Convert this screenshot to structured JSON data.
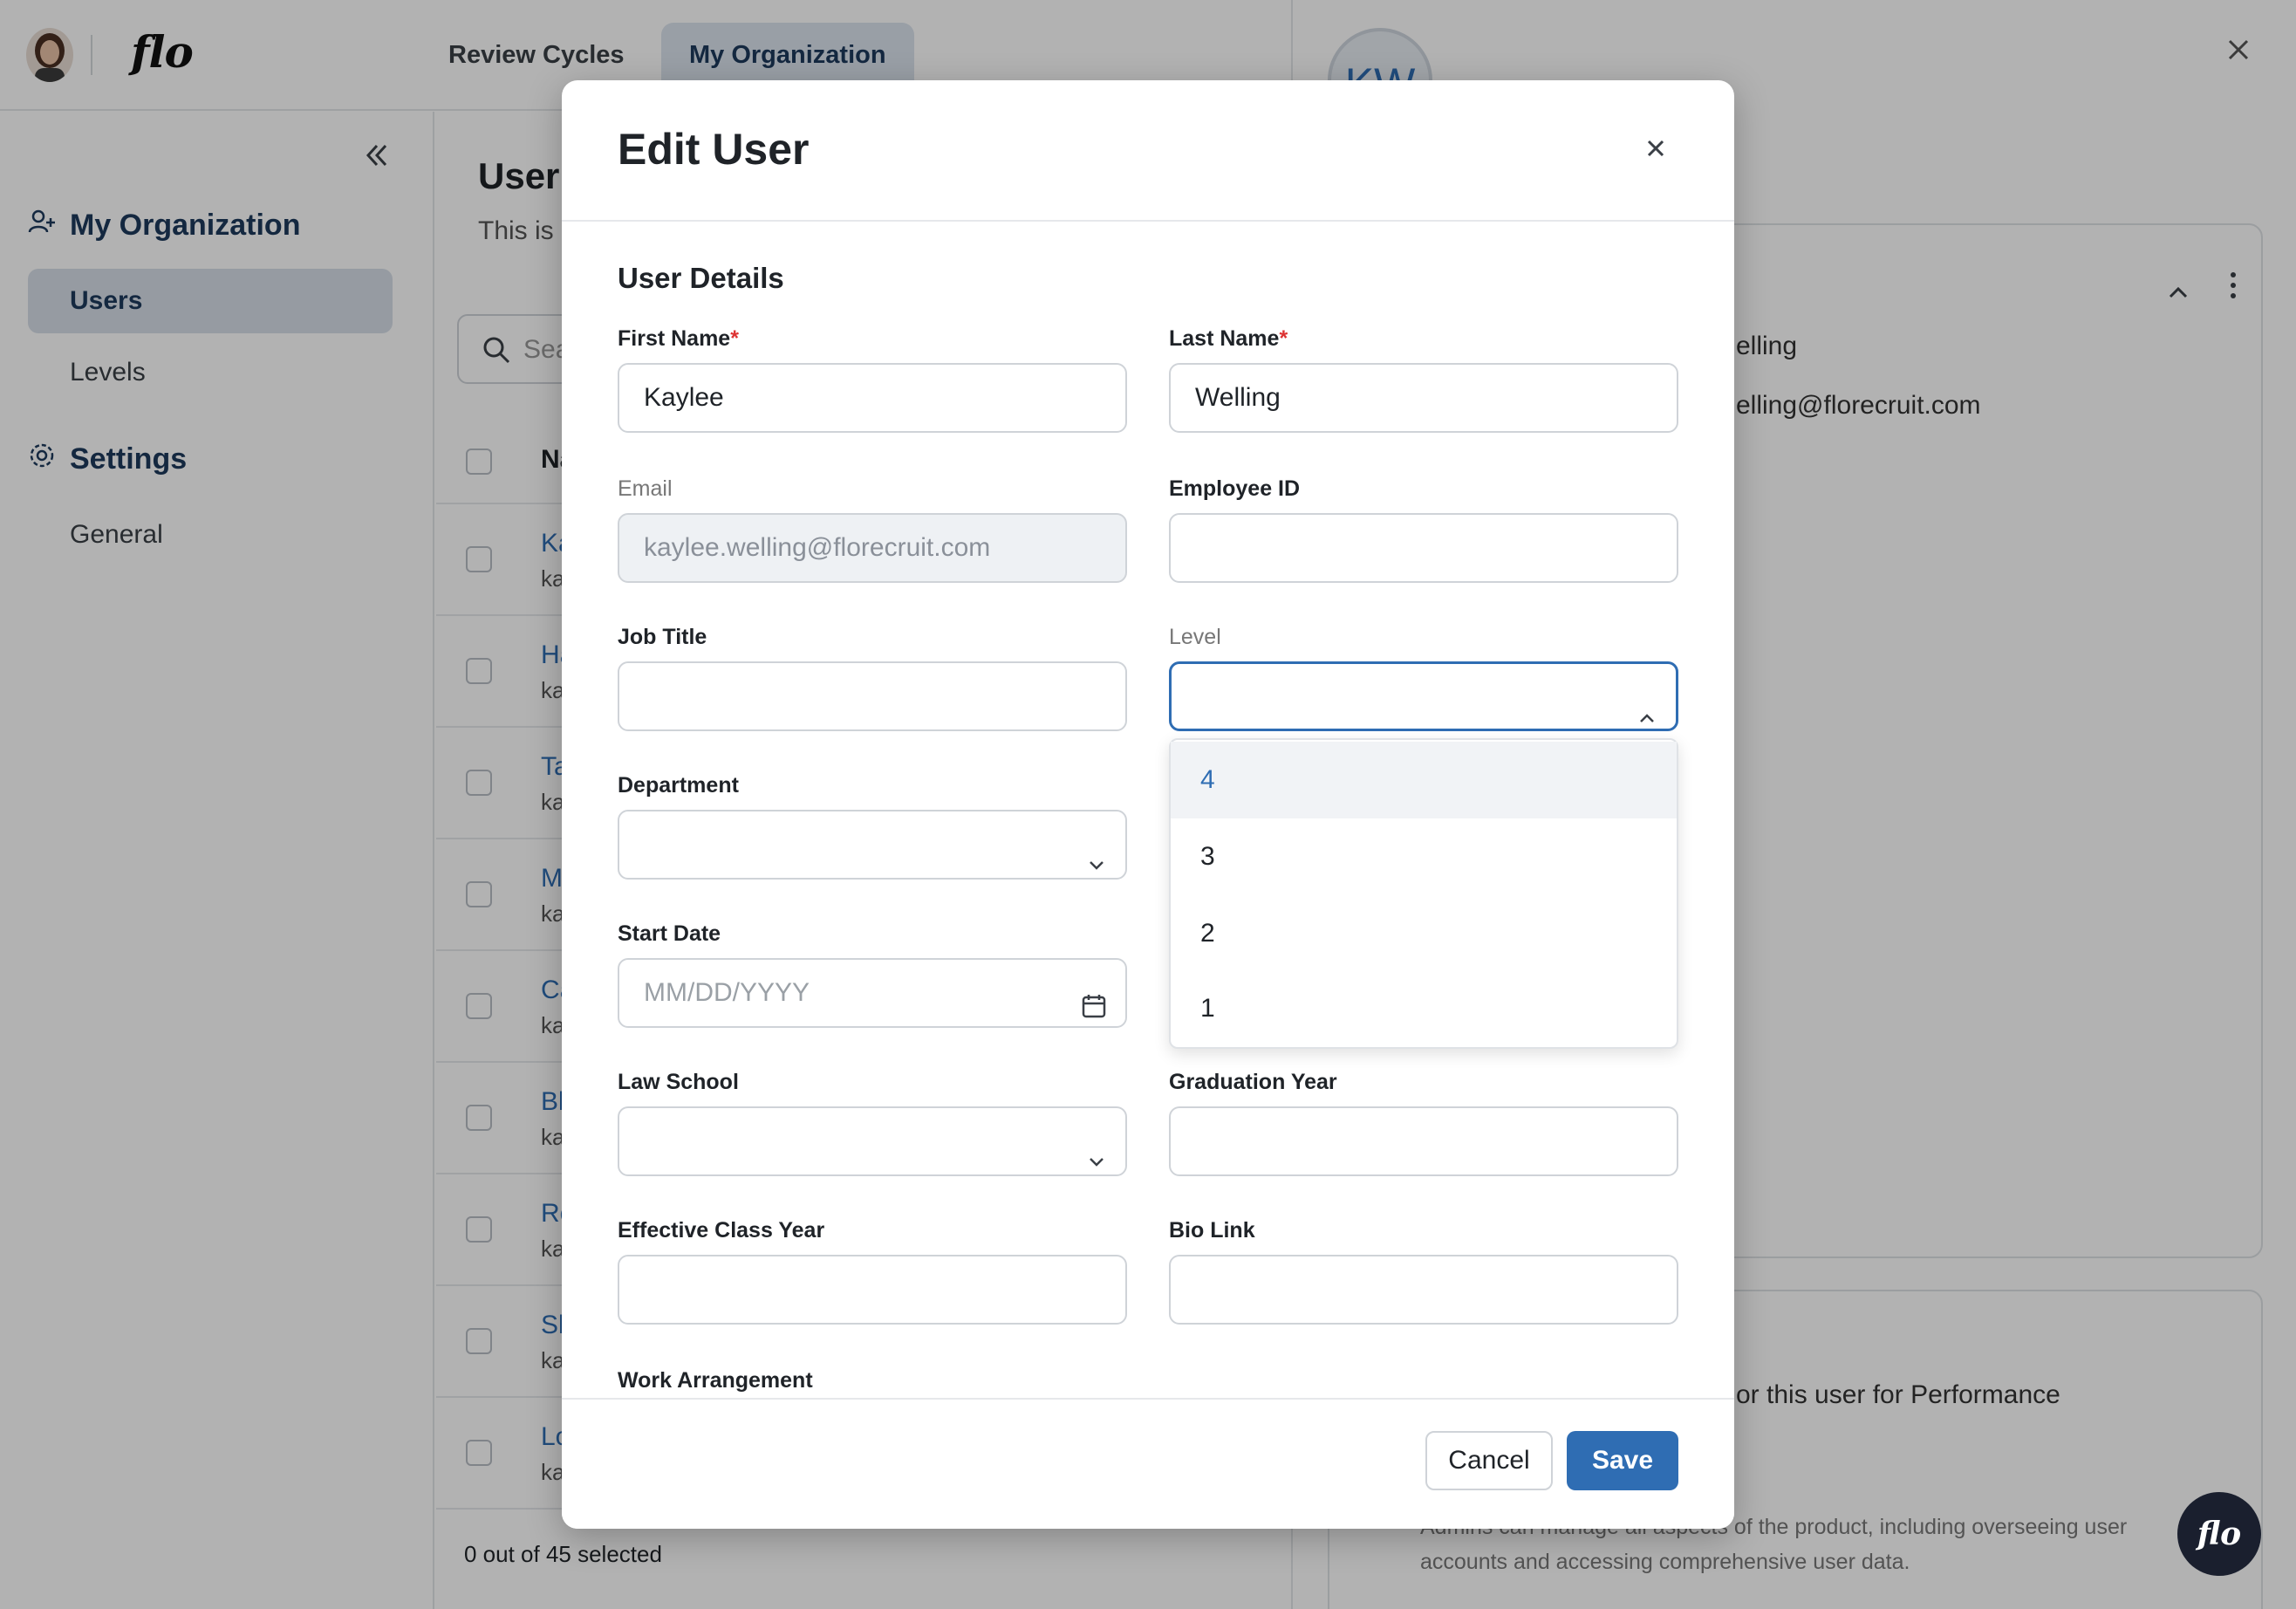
{
  "app": {
    "logo": "flo",
    "tabs": [
      {
        "label": "Review Cycles"
      },
      {
        "label": "My Organization"
      }
    ]
  },
  "sidebar": {
    "sections": [
      {
        "title": "My Organization",
        "icon": "user-plus-icon",
        "items": [
          {
            "label": "Users"
          },
          {
            "label": "Levels"
          }
        ]
      },
      {
        "title": "Settings",
        "icon": "gear-icon",
        "items": [
          {
            "label": "General"
          }
        ]
      }
    ]
  },
  "main": {
    "title": "User",
    "subtitle": "This is a",
    "search_placeholder": "Sea",
    "column_name": "Na",
    "rows": [
      {
        "name": "Ka",
        "email": "ka"
      },
      {
        "name": "Ha",
        "email": "ka"
      },
      {
        "name": "Ta",
        "email": "ka"
      },
      {
        "name": "M",
        "email": "ka"
      },
      {
        "name": "Ca",
        "email": "ka"
      },
      {
        "name": "Bl",
        "email": "ka"
      },
      {
        "name": "Ro",
        "email": "ka"
      },
      {
        "name": "Sh",
        "email": "ka"
      },
      {
        "name": "Lo",
        "email": "ka"
      }
    ],
    "selected_count": "0 out of 45 selected"
  },
  "detail": {
    "initials": "KW",
    "field1": "elling",
    "field2": "elling@florecruit.com",
    "card2_text": "or this user for Performance",
    "card2_desc": "Admins can manage all aspects of the product, including overseeing user accounts and accessing comprehensive user data."
  },
  "fab": {
    "label": "flo"
  },
  "modal": {
    "title": "Edit User",
    "section": "User Details",
    "fields": {
      "first_name": {
        "label": "First Name",
        "required": "*",
        "value": "Kaylee"
      },
      "last_name": {
        "label": "Last Name",
        "required": "*",
        "value": "Welling"
      },
      "email": {
        "label": "Email",
        "value": "kaylee.welling@florecruit.com"
      },
      "employee_id": {
        "label": "Employee ID",
        "value": ""
      },
      "job_title": {
        "label": "Job Title",
        "value": ""
      },
      "level": {
        "label": "Level",
        "value": "",
        "options": [
          "4",
          "3",
          "2",
          "1"
        ],
        "highlighted": "4"
      },
      "department": {
        "label": "Department",
        "value": ""
      },
      "start_date": {
        "label": "Start Date",
        "placeholder": "MM/DD/YYYY"
      },
      "law_school": {
        "label": "Law School",
        "value": ""
      },
      "graduation_year": {
        "label": "Graduation Year",
        "value": ""
      },
      "effective_class_year": {
        "label": "Effective Class Year",
        "value": ""
      },
      "bio_link": {
        "label": "Bio Link",
        "value": ""
      },
      "work_arrangement": {
        "label": "Work Arrangement"
      }
    },
    "buttons": {
      "cancel": "Cancel",
      "save": "Save"
    }
  },
  "colors": {
    "accent": "#2f6db3",
    "nav_active_bg": "#d7dfe9",
    "required": "#d33"
  }
}
